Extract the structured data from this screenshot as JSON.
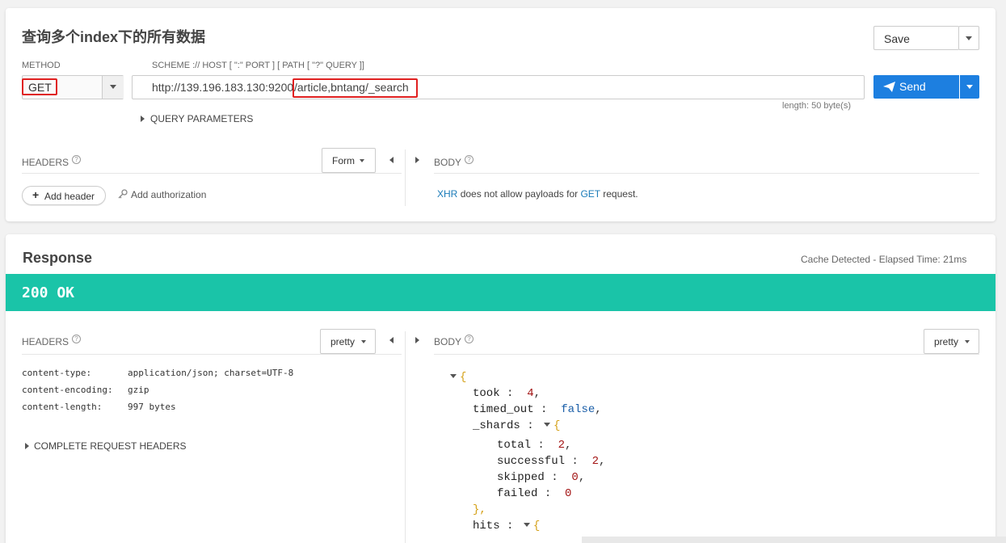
{
  "request": {
    "title": "查询多个index下的所有数据",
    "save_label": "Save",
    "method_label": "METHOD",
    "method": "GET",
    "scheme_label": "SCHEME :// HOST [ \":\" PORT ] [ PATH [ \"?\" QUERY ]]",
    "url_host": "http://139.196.183.130:9200",
    "url_path": "/article,bntang/_search",
    "send_label": "Send",
    "length_text": "length: 50 byte(s)",
    "query_params_label": "QUERY PARAMETERS",
    "headers_label": "HEADERS",
    "form_label": "Form",
    "add_header_label": "Add header",
    "add_auth_label": "Add authorization",
    "body_label": "BODY",
    "body_msg": {
      "xhr": "XHR",
      "middle": "does not allow payloads for",
      "get": "GET",
      "end": "request."
    }
  },
  "response": {
    "title": "Response",
    "cache_text": "Cache Detected - Elapsed Time: 21ms",
    "status": "200 OK",
    "status_color": "#1ac4a8",
    "headers_label": "HEADERS",
    "pretty_label": "pretty",
    "body_label": "BODY",
    "headers": [
      {
        "key": "content-type:",
        "value": "application/json; charset=UTF-8"
      },
      {
        "key": "content-encoding:",
        "value": "gzip"
      },
      {
        "key": "content-length:",
        "value": "997 bytes"
      }
    ],
    "complete_headers_label": "COMPLETE REQUEST HEADERS",
    "json": {
      "open": "{",
      "took_key": "took",
      "took_val": "4",
      "timed_out_key": "timed_out",
      "timed_out_val": "false",
      "shards_key": "_shards",
      "shards_open": "{",
      "total_key": "total",
      "total_val": "2",
      "successful_key": "successful",
      "successful_val": "2",
      "skipped_key": "skipped",
      "skipped_val": "0",
      "failed_key": "failed",
      "failed_val": "0",
      "shards_close": "},",
      "hits_key": "hits",
      "hits_open": "{"
    }
  }
}
